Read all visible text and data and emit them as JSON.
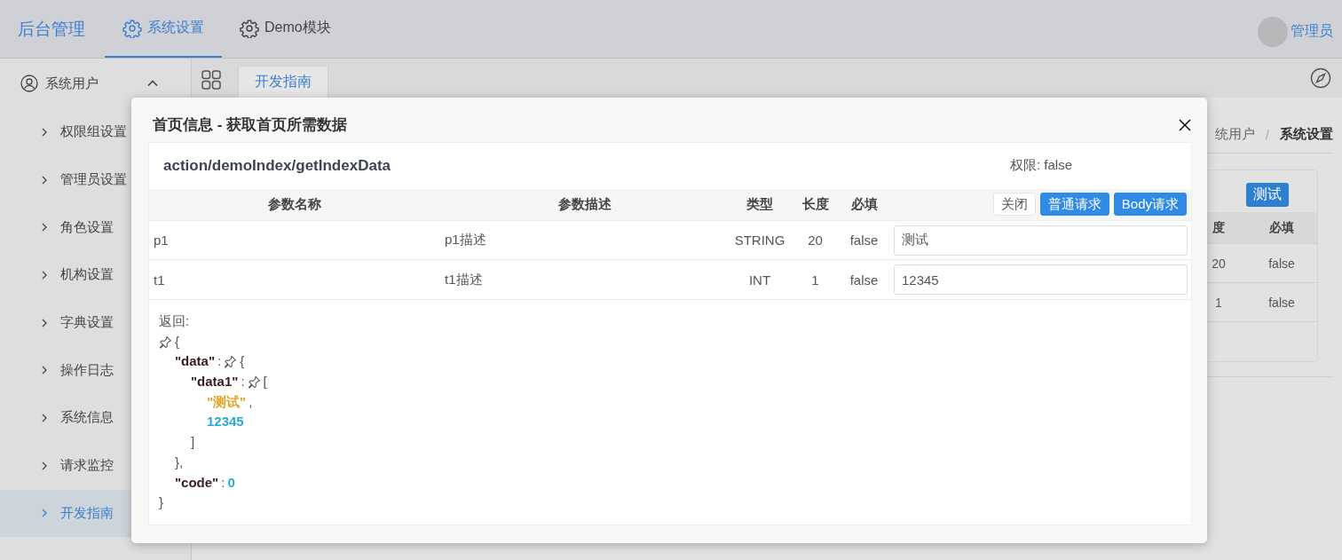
{
  "header": {
    "logo": "后台管理",
    "tabs": [
      {
        "label": "系统设置",
        "selected": true
      },
      {
        "label": "Demo模块",
        "selected": false
      }
    ],
    "user": {
      "name": "管理员"
    }
  },
  "sidebar": {
    "items": [
      {
        "label": "系统用户",
        "expanded": true,
        "children": [
          {
            "label": "权限组设置",
            "selected": false
          },
          {
            "label": "管理员设置",
            "selected": false
          },
          {
            "label": "角色设置",
            "selected": false
          },
          {
            "label": "机构设置",
            "selected": false
          },
          {
            "label": "字典设置",
            "selected": false
          },
          {
            "label": "操作日志",
            "selected": false
          },
          {
            "label": "系统信息",
            "selected": false
          },
          {
            "label": "请求监控",
            "selected": false
          },
          {
            "label": "开发指南",
            "selected": true
          }
        ]
      }
    ]
  },
  "tab_bar": {
    "tabs": [
      {
        "label": "开发指南",
        "selected": true
      }
    ]
  },
  "breadcrumb": {
    "items": [
      "统用户",
      "系统设置"
    ],
    "separator": "/"
  },
  "background_panel": {
    "button": "测试",
    "columns": [
      "度",
      "必填"
    ],
    "rows": [
      [
        "20",
        "false"
      ],
      [
        "1",
        "false"
      ]
    ]
  },
  "modal": {
    "title": "首页信息 - 获取首页所需数据",
    "endpoint": "action/demoIndex/getIndexData",
    "permission": "权限: false",
    "table": {
      "columns": [
        "参数名称",
        "参数描述",
        "类型",
        "长度",
        "必填"
      ],
      "buttons": [
        {
          "label": "关闭",
          "kind": "plain"
        },
        {
          "label": "普通请求",
          "kind": "primary"
        },
        {
          "label": "Body请求",
          "kind": "primary"
        }
      ],
      "rows": [
        {
          "name": "p1",
          "description": "p1描述",
          "type": "STRING",
          "length": "20",
          "required": "false",
          "value": "测试"
        },
        {
          "name": "t1",
          "description": "t1描述",
          "type": "INT",
          "length": "1",
          "required": "false",
          "value": "12345"
        }
      ]
    },
    "response": {
      "label": "返回:",
      "tree": {
        "open": "{",
        "close": "}",
        "children": [
          {
            "key": "\"data\"",
            "colon": ":",
            "open": "{",
            "close": "},",
            "children": [
              {
                "key": "\"data1\"",
                "colon": ":",
                "open": "[",
                "close": "]",
                "children": [
                  {
                    "value": "\"测试\"",
                    "kind": "string",
                    "comma": ","
                  },
                  {
                    "value": "12345",
                    "kind": "number"
                  }
                ]
              }
            ]
          },
          {
            "key": "\"code\"",
            "colon": ":",
            "value": "0",
            "kind": "number"
          }
        ]
      }
    }
  }
}
